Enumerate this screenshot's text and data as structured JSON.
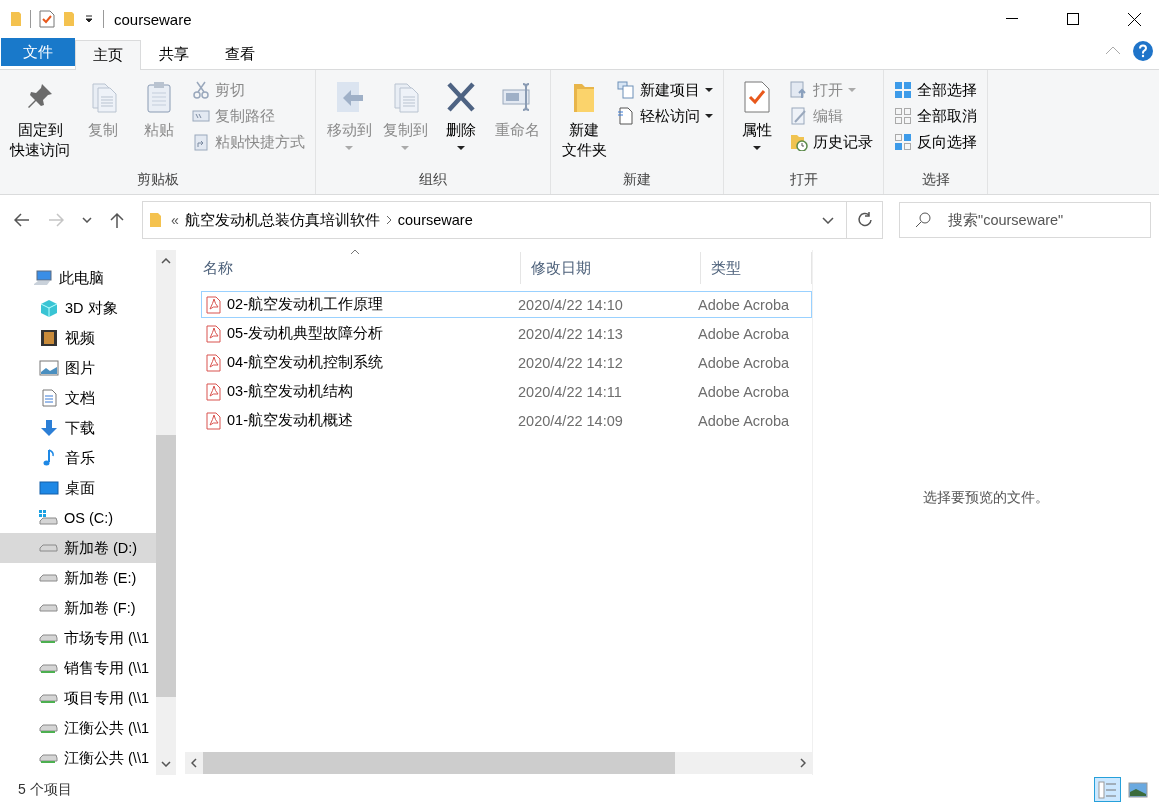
{
  "window": {
    "title": "courseware"
  },
  "ribbon_tabs": [
    {
      "label": "文件",
      "kind": "file",
      "selected": false
    },
    {
      "label": "主页",
      "kind": "tab",
      "selected": true
    },
    {
      "label": "共享",
      "kind": "tab",
      "selected": false
    },
    {
      "label": "查看",
      "kind": "tab",
      "selected": false
    }
  ],
  "ribbon": {
    "groups": [
      {
        "label": "剪贴板",
        "items": [
          {
            "kind": "large",
            "lines": [
              "固定到",
              "快速访问"
            ],
            "disabled": false,
            "dropdown": false
          },
          {
            "kind": "large",
            "label": "复制",
            "disabled": true,
            "dropdown": false
          },
          {
            "kind": "large",
            "label": "粘贴",
            "disabled": true,
            "dropdown": false
          },
          {
            "kind": "small",
            "label": "剪切",
            "disabled": true,
            "dropdown": false
          },
          {
            "kind": "small",
            "label": "复制路径",
            "disabled": true,
            "dropdown": false
          },
          {
            "kind": "small",
            "label": "粘贴快捷方式",
            "disabled": true,
            "dropdown": false
          }
        ]
      },
      {
        "label": "组织",
        "items": [
          {
            "kind": "large",
            "label": "移动到",
            "disabled": true,
            "dropdown": true
          },
          {
            "kind": "large",
            "label": "复制到",
            "disabled": true,
            "dropdown": true
          },
          {
            "kind": "large",
            "label": "删除",
            "disabled": false,
            "dropdown": true
          },
          {
            "kind": "large",
            "label": "重命名",
            "disabled": true,
            "dropdown": false
          }
        ]
      },
      {
        "label": "新建",
        "items": [
          {
            "kind": "large",
            "lines": [
              "新建",
              "文件夹"
            ],
            "disabled": false,
            "dropdown": false
          },
          {
            "kind": "small",
            "label": "新建项目",
            "disabled": false,
            "dropdown": true
          },
          {
            "kind": "small",
            "label": "轻松访问",
            "disabled": false,
            "dropdown": true
          }
        ]
      },
      {
        "label": "打开",
        "items": [
          {
            "kind": "large",
            "label": "属性",
            "disabled": false,
            "dropdown": true
          },
          {
            "kind": "small",
            "label": "打开",
            "disabled": true,
            "dropdown": true
          },
          {
            "kind": "small",
            "label": "编辑",
            "disabled": true,
            "dropdown": false
          },
          {
            "kind": "small",
            "label": "历史记录",
            "disabled": false,
            "dropdown": false
          }
        ]
      },
      {
        "label": "选择",
        "items": [
          {
            "kind": "small",
            "label": "全部选择",
            "disabled": false,
            "dropdown": false
          },
          {
            "kind": "small",
            "label": "全部取消",
            "disabled": false,
            "dropdown": false
          },
          {
            "kind": "small",
            "label": "反向选择",
            "disabled": false,
            "dropdown": false
          }
        ]
      }
    ]
  },
  "navigation": [
    {
      "kind": "back",
      "disabled": false
    },
    {
      "kind": "forward",
      "disabled": true
    },
    {
      "kind": "recent",
      "disabled": false
    },
    {
      "kind": "up",
      "disabled": false
    }
  ],
  "address": {
    "overflow": "«",
    "path": [
      "航空发动机总装仿真培训软件",
      "courseware"
    ]
  },
  "search": {
    "placeholder": "搜索\"courseware\""
  },
  "sidebar": {
    "items": [
      {
        "label": "此电脑",
        "selected": false,
        "children": [
          {
            "label": "3D 对象",
            "selected": false
          },
          {
            "label": "视频",
            "selected": false
          },
          {
            "label": "图片",
            "selected": false
          },
          {
            "label": "文档",
            "selected": false
          },
          {
            "label": "下载",
            "selected": false
          },
          {
            "label": "音乐",
            "selected": false
          },
          {
            "label": "桌面",
            "selected": false
          },
          {
            "label": "OS (C:)",
            "selected": false
          },
          {
            "label": "新加卷 (D:)",
            "selected": true
          },
          {
            "label": "新加卷 (E:)",
            "selected": false
          },
          {
            "label": "新加卷 (F:)",
            "selected": false
          },
          {
            "label": "市场专用 (\\\\1",
            "selected": false
          },
          {
            "label": "销售专用 (\\\\1",
            "selected": false
          },
          {
            "label": "项目专用 (\\\\1",
            "selected": false
          },
          {
            "label": "江衡公共 (\\\\1",
            "selected": false
          },
          {
            "label": "江衡公共 (\\\\1",
            "selected": false
          }
        ]
      }
    ]
  },
  "files": {
    "columns": [
      {
        "label": "名称",
        "sorted": true
      },
      {
        "label": "修改日期"
      },
      {
        "label": "类型"
      }
    ],
    "rows": [
      {
        "name": "02-航空发动机工作原理",
        "modified": "2020/4/22 14:10",
        "type": "Adobe Acroba",
        "focused": true
      },
      {
        "name": "05-发动机典型故障分析",
        "modified": "2020/4/22 14:13",
        "type": "Adobe Acroba",
        "focused": false
      },
      {
        "name": "04-航空发动机控制系统",
        "modified": "2020/4/22 14:12",
        "type": "Adobe Acroba",
        "focused": false
      },
      {
        "name": "03-航空发动机结构",
        "modified": "2020/4/22 14:11",
        "type": "Adobe Acroba",
        "focused": false
      },
      {
        "name": "01-航空发动机概述",
        "modified": "2020/4/22 14:09",
        "type": "Adobe Acroba",
        "focused": false
      }
    ]
  },
  "preview": {
    "message": "选择要预览的文件。"
  },
  "status_bar": {
    "count": "5 个项目",
    "view_buttons": [
      {
        "kind": "details",
        "selected": true
      },
      {
        "kind": "thumbnails",
        "selected": false
      }
    ]
  }
}
